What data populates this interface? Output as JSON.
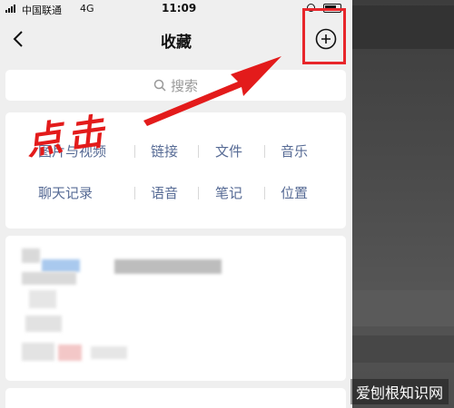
{
  "status_bar": {
    "carrier": "中国联通",
    "network": "4G",
    "time": "11:09"
  },
  "nav": {
    "title": "收藏"
  },
  "search": {
    "placeholder": "搜索"
  },
  "categories": {
    "row1": [
      "图片与视频",
      "链接",
      "文件",
      "音乐"
    ],
    "row2": [
      "聊天记录",
      "语音",
      "笔记",
      "位置"
    ]
  },
  "annotation": {
    "handwritten": "点击",
    "color": "#e31b1b"
  },
  "watermark": "爱刨根知识网",
  "colors": {
    "link": "#576b95",
    "highlight": "#e8262b",
    "background": "#efefef"
  },
  "icons": [
    "back-chevron-icon",
    "add-circle-icon",
    "search-icon",
    "lock-rotation-icon",
    "battery-icon"
  ]
}
